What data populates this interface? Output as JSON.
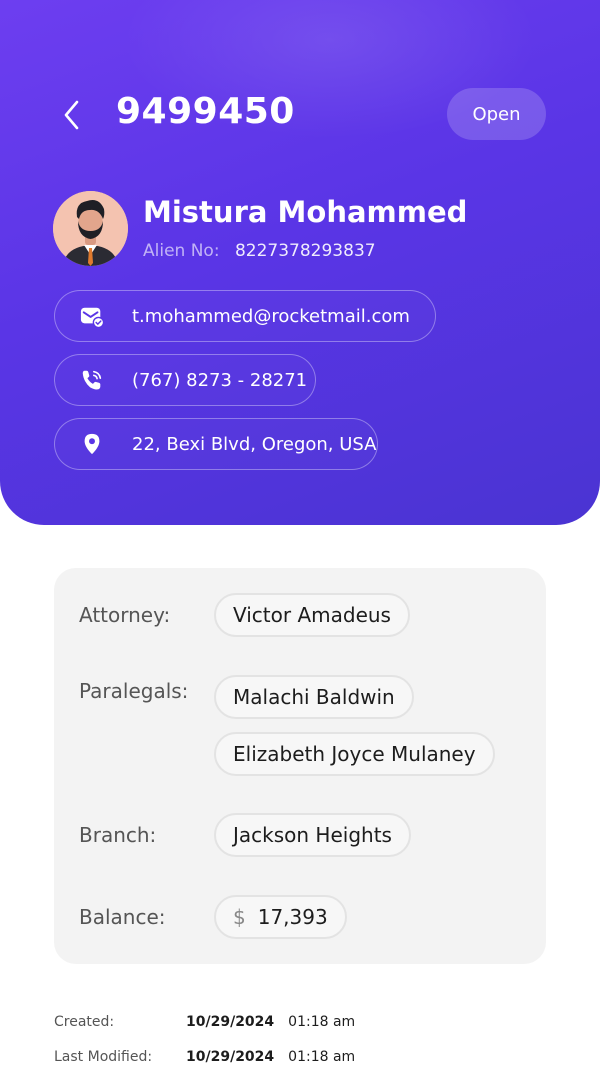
{
  "header": {
    "case_number": "9499450",
    "status": "Open"
  },
  "client": {
    "name": "Mistura Mohammed",
    "alien_label": "Alien No:",
    "alien_number": "8227378293837",
    "email": "t.mohammed@rocketmail.com",
    "phone": "(767) 8273 - 28271",
    "address": "22, Bexi Blvd, Oregon, USA"
  },
  "details": {
    "attorney_label": "Attorney:",
    "attorney": "Victor Amadeus",
    "paralegals_label": "Paralegals:",
    "paralegals": [
      "Malachi Baldwin",
      "Elizabeth Joyce Mulaney"
    ],
    "branch_label": "Branch:",
    "branch": "Jackson Heights",
    "balance_label": "Balance:",
    "balance_currency": "$",
    "balance": "17,393"
  },
  "meta": {
    "created_label": "Created:",
    "created_date": "10/29/2024",
    "created_time": "01:18 am",
    "modified_label": "Last Modified:",
    "modified_date": "10/29/2024",
    "modified_time": "01:18 am"
  },
  "icons": {
    "back": "chevron-left-icon",
    "email": "mail-icon",
    "phone": "phone-icon",
    "address": "location-pin-icon"
  },
  "colors": {
    "header_gradient_start": "#6d3ef0",
    "header_gradient_end": "#4a34d2",
    "card_background": "#f3f3f3"
  }
}
